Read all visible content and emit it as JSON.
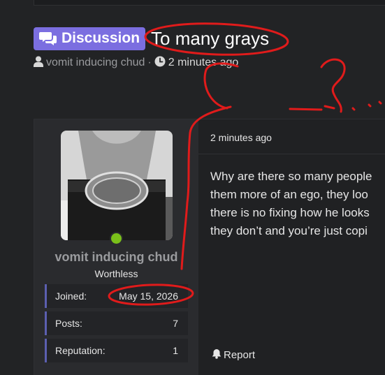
{
  "thread": {
    "badge_label": "Discussion",
    "title": "To many grays",
    "author": "vomit inducing chud",
    "separator": "·",
    "time": "2 minutes ago"
  },
  "post": {
    "time": "2 minutes ago",
    "body_lines": [
      "Why are there so many people",
      "them more of an ego, they loo",
      "there is no fixing how he looks",
      "they don’t and you’re just copi"
    ],
    "report_label": "Report"
  },
  "author_panel": {
    "username": "vomit inducing chud",
    "rank": "Worthless",
    "online_color": "#7ac01a",
    "stats": [
      {
        "label": "Joined:",
        "value": "May 15, 2026"
      },
      {
        "label": "Posts:",
        "value": "7"
      },
      {
        "label": "Reputation:",
        "value": "1"
      }
    ]
  },
  "icons": {
    "badge": "comments-icon",
    "author": "user-icon",
    "time": "clock-icon",
    "report": "bell-icon"
  },
  "colors": {
    "accent": "#7b6ee0",
    "stat_border": "#5b5fb0",
    "annotation": "#e01b1b"
  }
}
